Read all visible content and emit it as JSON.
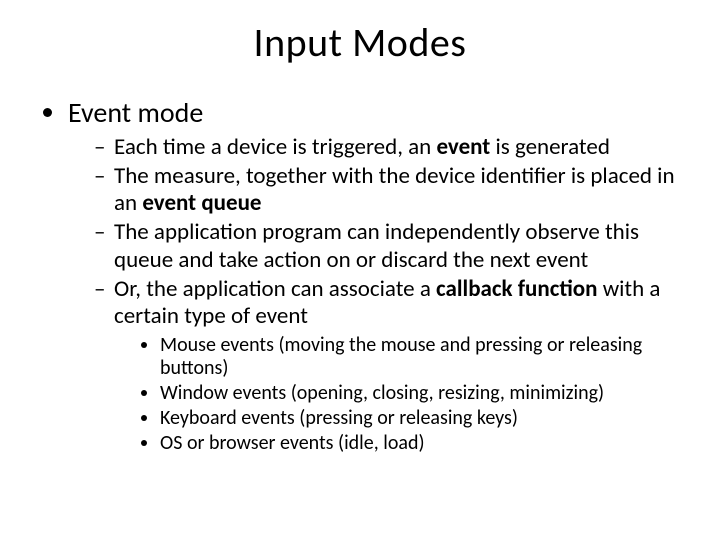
{
  "title": "Input Modes",
  "level1": {
    "item1": "Event mode"
  },
  "level2": {
    "i1_pre": "Each time a device is triggered, an ",
    "i1_bold": "event",
    "i1_post": " is generated",
    "i2_pre": "The measure, together with the device identifier is placed in an ",
    "i2_bold": "event queue",
    "i3": "The application program can independently observe this queue and take action on or discard the next event",
    "i4_pre": "Or, the application can associate a ",
    "i4_bold": "callback function",
    "i4_post": " with a certain type of event"
  },
  "level3": {
    "e1": "Mouse events (moving the mouse and pressing or releasing buttons)",
    "e2": "Window events (opening, closing, resizing, minimizing)",
    "e3": "Keyboard events (pressing or releasing keys)",
    "e4": "OS or browser events (idle, load)"
  }
}
